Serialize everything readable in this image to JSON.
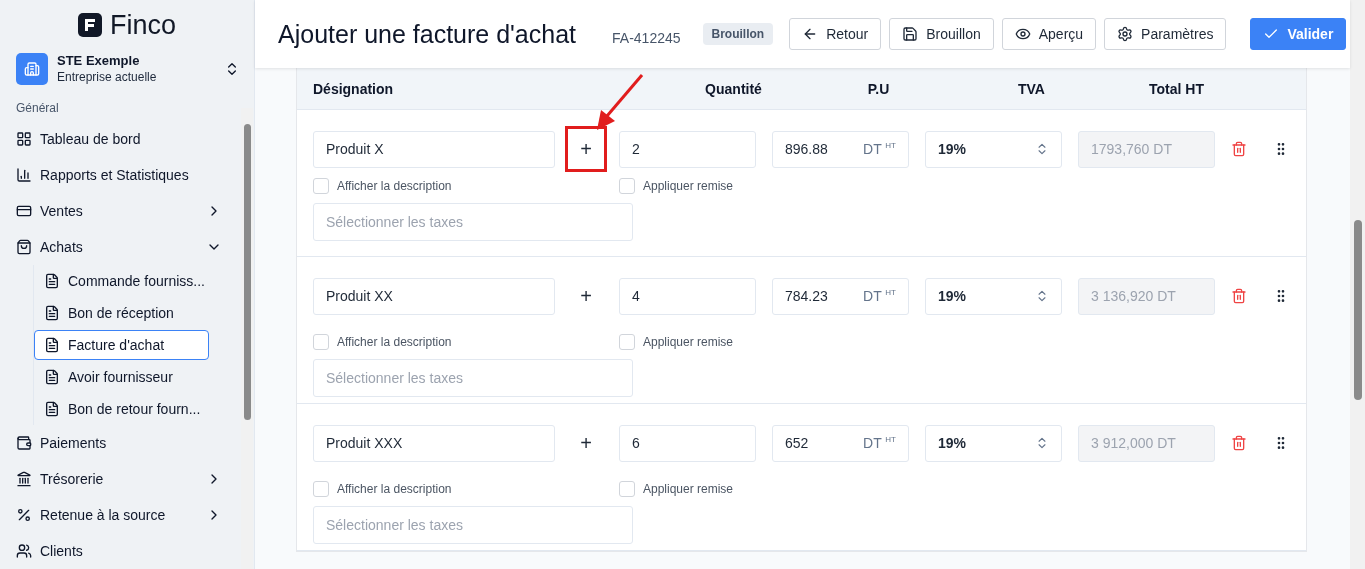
{
  "sidebar": {
    "logo": "Finco",
    "company": {
      "name": "STE Exemple",
      "subtitle": "Entreprise actuelle"
    },
    "section": "Général",
    "items": [
      {
        "label": "Tableau de bord"
      },
      {
        "label": "Rapports et Statistiques"
      },
      {
        "label": "Ventes",
        "expanded": false
      },
      {
        "label": "Achats",
        "expanded": true,
        "children": [
          {
            "label": "Commande fourniss...",
            "selected": false
          },
          {
            "label": "Bon de réception",
            "selected": false
          },
          {
            "label": "Facture d'achat",
            "selected": true
          },
          {
            "label": "Avoir fournisseur",
            "selected": false
          },
          {
            "label": "Bon de retour fourn...",
            "selected": false
          }
        ]
      },
      {
        "label": "Paiements"
      },
      {
        "label": "Trésorerie",
        "expanded": false
      },
      {
        "label": "Retenue à la source",
        "expanded": false
      },
      {
        "label": "Clients"
      }
    ]
  },
  "header": {
    "title": "Ajouter une facture d'achat",
    "number": "FA-412245",
    "status": "Brouillon",
    "buttons": [
      {
        "label": "Retour",
        "kind": "outline"
      },
      {
        "label": "Brouillon",
        "kind": "outline"
      },
      {
        "label": "Aperçu",
        "kind": "outline"
      },
      {
        "label": "Paramètres",
        "kind": "outline"
      },
      {
        "label": "Valider",
        "kind": "primary"
      }
    ]
  },
  "table": {
    "columns": [
      "Désignation",
      "Quantité",
      "P.U",
      "TVA",
      "Total HT"
    ],
    "rows": [
      {
        "designation": "Produit X",
        "plus": "+",
        "highlighted": true,
        "quantity": "2",
        "unit_price": "896.88",
        "currency": "DT",
        "price_suffix": "HT",
        "vat": "19%",
        "total": "1793,760 DT",
        "description": {
          "label": "Afficher la description",
          "checked": false
        },
        "discount": {
          "label": "Appliquer remise",
          "checked": false
        },
        "taxes_placeholder": "Sélectionner les taxes"
      },
      {
        "designation": "Produit XX",
        "plus": "+",
        "highlighted": false,
        "quantity": "4",
        "unit_price": "784.23",
        "currency": "DT",
        "price_suffix": "HT",
        "vat": "19%",
        "total": "3 136,920 DT",
        "description": {
          "label": "Afficher la description",
          "checked": false
        },
        "discount": {
          "label": "Appliquer remise",
          "checked": false
        },
        "taxes_placeholder": "Sélectionner les taxes"
      },
      {
        "designation": "Produit XXX",
        "plus": "+",
        "highlighted": false,
        "quantity": "6",
        "unit_price": "652",
        "currency": "DT",
        "price_suffix": "HT",
        "vat": "19%",
        "total": "3 912,000 DT",
        "description": {
          "label": "Afficher la description",
          "checked": false
        },
        "discount": {
          "label": "Appliquer remise",
          "checked": false
        },
        "taxes_placeholder": "Sélectionner les taxes"
      }
    ]
  }
}
